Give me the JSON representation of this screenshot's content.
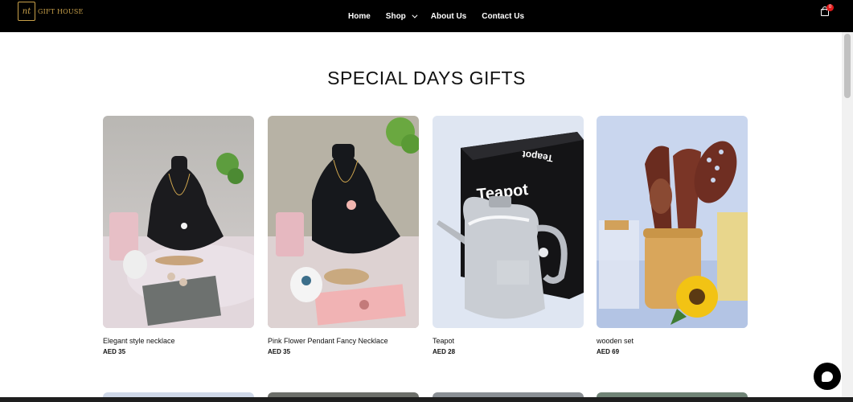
{
  "header": {
    "logo_mark": "nt",
    "logo_text": "GIFT HOUSE",
    "nav": [
      {
        "label": "Home"
      },
      {
        "label": "Shop",
        "has_dropdown": true
      },
      {
        "label": "About Us"
      },
      {
        "label": "Contact Us"
      }
    ],
    "cart_count": "0"
  },
  "section": {
    "title": "SPECIAL DAYS GIFTS"
  },
  "products": [
    {
      "name": "Elegant style necklace",
      "price": "AED 35"
    },
    {
      "name": "Pink Flower Pendant Fancy Necklace",
      "price": "AED 35"
    },
    {
      "name": "Teapot",
      "price": "AED 28"
    },
    {
      "name": "wooden set",
      "price": "AED 69"
    }
  ],
  "colors": {
    "nav_bg": "#000000",
    "logo_gold": "#c9a14a",
    "badge_red": "#e11b1b"
  }
}
